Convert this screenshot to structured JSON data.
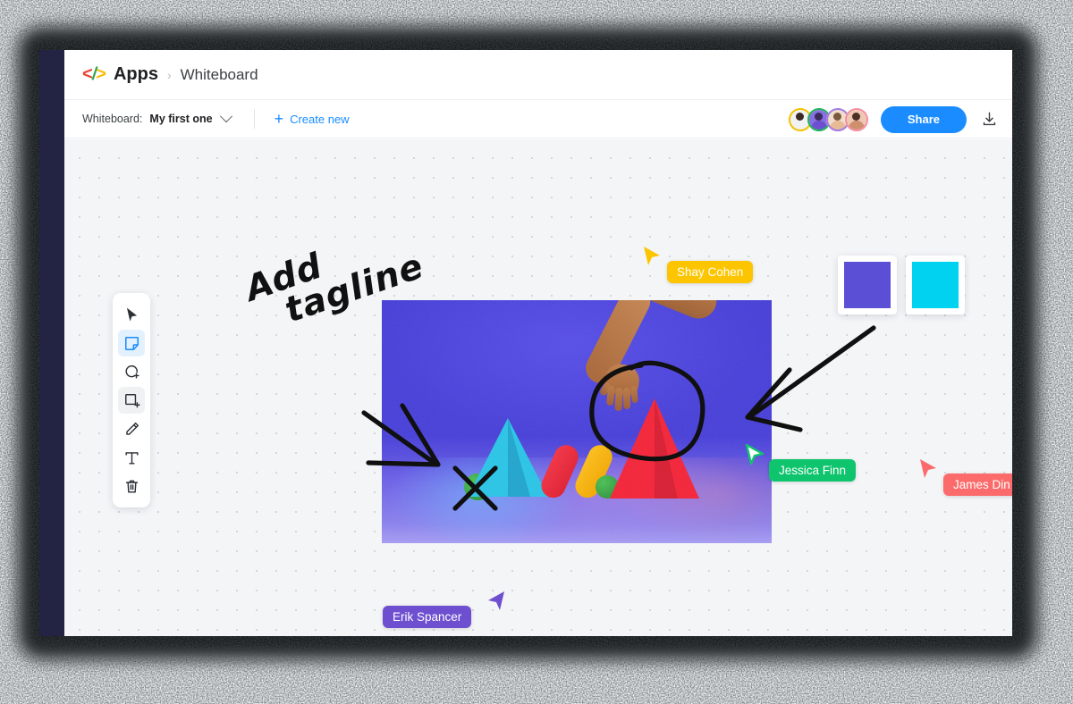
{
  "app": {
    "brand": "Apps",
    "logo_glyph": {
      "lt": "<",
      "slash": "/",
      "gt": ">"
    },
    "breadcrumb_separator": "›",
    "current_page": "Whiteboard"
  },
  "toolbar": {
    "whiteboard_label": "Whiteboard:",
    "selected_whiteboard": "My first one",
    "dropdown_icon": "chevron-down-icon",
    "create_new_label": "Create new",
    "create_new_icon": "plus-icon",
    "share_label": "Share",
    "download_icon": "download-icon",
    "accent_blue": "#1a8cff"
  },
  "collaborators": [
    {
      "name": "Shay Cohen",
      "ring_color": "#f2c200",
      "skin": "#3a2a24",
      "shirt": "#f2f2f2"
    },
    {
      "name": "Erik Spancer",
      "ring_color": "#21b35e",
      "skin": "#6d4fd0",
      "shirt": "#8a6fe0"
    },
    {
      "name": "James Din",
      "ring_color": "#a37be0",
      "skin": "#e8bb96",
      "shirt": "#f0ddcb"
    },
    {
      "name": "Jessica Finn",
      "ring_color": "#f48fa0",
      "skin": "#cf8f6e",
      "shirt": "#efc8b4"
    }
  ],
  "tools": [
    {
      "name": "select-tool",
      "icon": "cursor-arrow-icon",
      "active": false,
      "state": "default"
    },
    {
      "name": "sticky-note-tool",
      "icon": "sticky-note-icon",
      "active": true,
      "state": "active"
    },
    {
      "name": "comment-tool",
      "icon": "comment-plus-icon",
      "active": false,
      "state": "default"
    },
    {
      "name": "frame-tool",
      "icon": "frame-plus-icon",
      "active": false,
      "state": "hover"
    },
    {
      "name": "pen-tool",
      "icon": "pencil-icon",
      "active": false,
      "state": "default"
    },
    {
      "name": "text-tool",
      "icon": "text-icon",
      "active": false,
      "state": "default"
    },
    {
      "name": "delete-tool",
      "icon": "trash-icon",
      "active": false,
      "state": "default"
    }
  ],
  "canvas": {
    "background": "#f4f5f7",
    "dot_color": "#d3d6dd",
    "handwriting": {
      "line1": "Add",
      "line2": "tagline"
    },
    "swatches": [
      {
        "name": "indigo-swatch",
        "color": "#5b4fd6"
      },
      {
        "name": "cyan-swatch",
        "color": "#00d2f0"
      }
    ],
    "image": {
      "name": "shapes-hero-image",
      "background_top": "#4a42d9",
      "background_bottom": "#a89ff4",
      "shapes": [
        "cyan-pyramid",
        "red-capsule",
        "yellow-capsule",
        "green-sphere",
        "green-sphere",
        "red-pyramid",
        "hand"
      ]
    },
    "annotations": [
      {
        "name": "arrow-to-image-left",
        "type": "arrow"
      },
      {
        "name": "arrow-from-swatches",
        "type": "arrow"
      },
      {
        "name": "x-mark-on-cyan-pyramid",
        "type": "x"
      },
      {
        "name": "circle-around-hand",
        "type": "circle"
      }
    ]
  },
  "cursors": [
    {
      "name": "Shay Cohen",
      "color": "#fdc500"
    },
    {
      "name": "Jessica Finn",
      "color": "#0ec46d"
    },
    {
      "name": "James Din",
      "color": "#fc6b6b"
    },
    {
      "name": "Erik Spancer",
      "color": "#6d4fd0"
    }
  ]
}
